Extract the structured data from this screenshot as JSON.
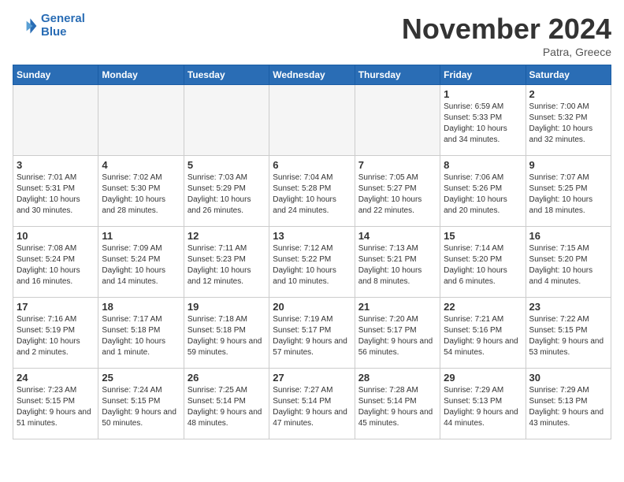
{
  "header": {
    "logo_line1": "General",
    "logo_line2": "Blue",
    "month_title": "November 2024",
    "location": "Patra, Greece"
  },
  "weekdays": [
    "Sunday",
    "Monday",
    "Tuesday",
    "Wednesday",
    "Thursday",
    "Friday",
    "Saturday"
  ],
  "weeks": [
    [
      {
        "day": "",
        "empty": true
      },
      {
        "day": "",
        "empty": true
      },
      {
        "day": "",
        "empty": true
      },
      {
        "day": "",
        "empty": true
      },
      {
        "day": "",
        "empty": true
      },
      {
        "day": "1",
        "sunrise": "Sunrise: 6:59 AM",
        "sunset": "Sunset: 5:33 PM",
        "daylight": "Daylight: 10 hours and 34 minutes."
      },
      {
        "day": "2",
        "sunrise": "Sunrise: 7:00 AM",
        "sunset": "Sunset: 5:32 PM",
        "daylight": "Daylight: 10 hours and 32 minutes."
      }
    ],
    [
      {
        "day": "3",
        "sunrise": "Sunrise: 7:01 AM",
        "sunset": "Sunset: 5:31 PM",
        "daylight": "Daylight: 10 hours and 30 minutes."
      },
      {
        "day": "4",
        "sunrise": "Sunrise: 7:02 AM",
        "sunset": "Sunset: 5:30 PM",
        "daylight": "Daylight: 10 hours and 28 minutes."
      },
      {
        "day": "5",
        "sunrise": "Sunrise: 7:03 AM",
        "sunset": "Sunset: 5:29 PM",
        "daylight": "Daylight: 10 hours and 26 minutes."
      },
      {
        "day": "6",
        "sunrise": "Sunrise: 7:04 AM",
        "sunset": "Sunset: 5:28 PM",
        "daylight": "Daylight: 10 hours and 24 minutes."
      },
      {
        "day": "7",
        "sunrise": "Sunrise: 7:05 AM",
        "sunset": "Sunset: 5:27 PM",
        "daylight": "Daylight: 10 hours and 22 minutes."
      },
      {
        "day": "8",
        "sunrise": "Sunrise: 7:06 AM",
        "sunset": "Sunset: 5:26 PM",
        "daylight": "Daylight: 10 hours and 20 minutes."
      },
      {
        "day": "9",
        "sunrise": "Sunrise: 7:07 AM",
        "sunset": "Sunset: 5:25 PM",
        "daylight": "Daylight: 10 hours and 18 minutes."
      }
    ],
    [
      {
        "day": "10",
        "sunrise": "Sunrise: 7:08 AM",
        "sunset": "Sunset: 5:24 PM",
        "daylight": "Daylight: 10 hours and 16 minutes."
      },
      {
        "day": "11",
        "sunrise": "Sunrise: 7:09 AM",
        "sunset": "Sunset: 5:24 PM",
        "daylight": "Daylight: 10 hours and 14 minutes."
      },
      {
        "day": "12",
        "sunrise": "Sunrise: 7:11 AM",
        "sunset": "Sunset: 5:23 PM",
        "daylight": "Daylight: 10 hours and 12 minutes."
      },
      {
        "day": "13",
        "sunrise": "Sunrise: 7:12 AM",
        "sunset": "Sunset: 5:22 PM",
        "daylight": "Daylight: 10 hours and 10 minutes."
      },
      {
        "day": "14",
        "sunrise": "Sunrise: 7:13 AM",
        "sunset": "Sunset: 5:21 PM",
        "daylight": "Daylight: 10 hours and 8 minutes."
      },
      {
        "day": "15",
        "sunrise": "Sunrise: 7:14 AM",
        "sunset": "Sunset: 5:20 PM",
        "daylight": "Daylight: 10 hours and 6 minutes."
      },
      {
        "day": "16",
        "sunrise": "Sunrise: 7:15 AM",
        "sunset": "Sunset: 5:20 PM",
        "daylight": "Daylight: 10 hours and 4 minutes."
      }
    ],
    [
      {
        "day": "17",
        "sunrise": "Sunrise: 7:16 AM",
        "sunset": "Sunset: 5:19 PM",
        "daylight": "Daylight: 10 hours and 2 minutes."
      },
      {
        "day": "18",
        "sunrise": "Sunrise: 7:17 AM",
        "sunset": "Sunset: 5:18 PM",
        "daylight": "Daylight: 10 hours and 1 minute."
      },
      {
        "day": "19",
        "sunrise": "Sunrise: 7:18 AM",
        "sunset": "Sunset: 5:18 PM",
        "daylight": "Daylight: 9 hours and 59 minutes."
      },
      {
        "day": "20",
        "sunrise": "Sunrise: 7:19 AM",
        "sunset": "Sunset: 5:17 PM",
        "daylight": "Daylight: 9 hours and 57 minutes."
      },
      {
        "day": "21",
        "sunrise": "Sunrise: 7:20 AM",
        "sunset": "Sunset: 5:17 PM",
        "daylight": "Daylight: 9 hours and 56 minutes."
      },
      {
        "day": "22",
        "sunrise": "Sunrise: 7:21 AM",
        "sunset": "Sunset: 5:16 PM",
        "daylight": "Daylight: 9 hours and 54 minutes."
      },
      {
        "day": "23",
        "sunrise": "Sunrise: 7:22 AM",
        "sunset": "Sunset: 5:15 PM",
        "daylight": "Daylight: 9 hours and 53 minutes."
      }
    ],
    [
      {
        "day": "24",
        "sunrise": "Sunrise: 7:23 AM",
        "sunset": "Sunset: 5:15 PM",
        "daylight": "Daylight: 9 hours and 51 minutes."
      },
      {
        "day": "25",
        "sunrise": "Sunrise: 7:24 AM",
        "sunset": "Sunset: 5:15 PM",
        "daylight": "Daylight: 9 hours and 50 minutes."
      },
      {
        "day": "26",
        "sunrise": "Sunrise: 7:25 AM",
        "sunset": "Sunset: 5:14 PM",
        "daylight": "Daylight: 9 hours and 48 minutes."
      },
      {
        "day": "27",
        "sunrise": "Sunrise: 7:27 AM",
        "sunset": "Sunset: 5:14 PM",
        "daylight": "Daylight: 9 hours and 47 minutes."
      },
      {
        "day": "28",
        "sunrise": "Sunrise: 7:28 AM",
        "sunset": "Sunset: 5:14 PM",
        "daylight": "Daylight: 9 hours and 45 minutes."
      },
      {
        "day": "29",
        "sunrise": "Sunrise: 7:29 AM",
        "sunset": "Sunset: 5:13 PM",
        "daylight": "Daylight: 9 hours and 44 minutes."
      },
      {
        "day": "30",
        "sunrise": "Sunrise: 7:29 AM",
        "sunset": "Sunset: 5:13 PM",
        "daylight": "Daylight: 9 hours and 43 minutes."
      }
    ]
  ]
}
